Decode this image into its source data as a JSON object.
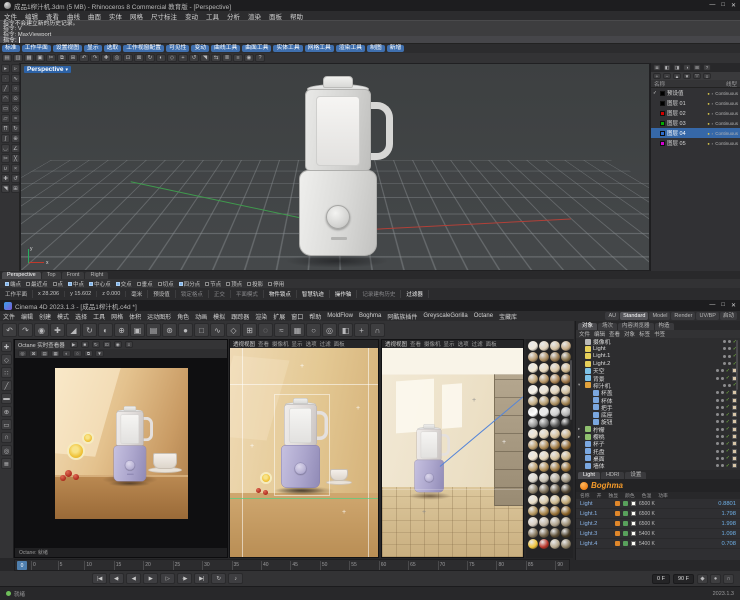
{
  "rhino": {
    "title": "成品1榨汁机.3dm (5 MB) - Rhinoceros 8 Commercial 教育版 - [Perspective]",
    "window_buttons": [
      "—",
      "□",
      "✕"
    ],
    "menus": [
      "文件",
      "编辑",
      "查看",
      "曲线",
      "曲面",
      "实体",
      "网格",
      "尺寸标注",
      "变动",
      "工具",
      "分析",
      "渲染",
      "面板",
      "帮助"
    ],
    "command_history": [
      "指令不会建立新的历史记录。",
      "指令: V",
      "指令: MaxViewport"
    ],
    "command_prompt": "指令:",
    "toolbar_tabs": [
      "标准",
      "工作平面",
      "设置视图",
      "显示",
      "选取",
      "工作视窗配置",
      "可见性",
      "变动",
      "曲线工具",
      "曲面工具",
      "实体工具",
      "网格工具",
      "渲染工具",
      "制图",
      "新增"
    ],
    "toolbar_icons": [
      {
        "n": "new-file-icon",
        "g": "▤"
      },
      {
        "n": "open-file-icon",
        "g": "▥"
      },
      {
        "n": "save-icon",
        "g": "▦"
      },
      {
        "n": "print-icon",
        "g": "▣"
      },
      {
        "n": "cut-icon",
        "g": "✂"
      },
      {
        "n": "copy-icon",
        "g": "⧉"
      },
      {
        "n": "paste-icon",
        "g": "⊞"
      },
      {
        "n": "undo-icon",
        "g": "↶"
      },
      {
        "n": "redo-icon",
        "g": "↷"
      },
      {
        "n": "pan-view-icon",
        "g": "✚"
      },
      {
        "n": "zoom-icon",
        "g": "◎"
      },
      {
        "n": "zoom-window-icon",
        "g": "⊡"
      },
      {
        "n": "zoom-extents-icon",
        "g": "⊠"
      },
      {
        "n": "rotate-view-icon",
        "g": "↻"
      },
      {
        "n": "shaded-display-icon",
        "g": "◐"
      },
      {
        "n": "wireframe-display-icon",
        "g": "◇"
      },
      {
        "n": "move-icon",
        "g": "+"
      },
      {
        "n": "rotate-icon",
        "g": "↺"
      },
      {
        "n": "scale-icon",
        "g": "◥"
      },
      {
        "n": "mirror-icon",
        "g": "⇆"
      },
      {
        "n": "layers-icon",
        "g": "≣"
      },
      {
        "n": "properties-icon",
        "g": "≡"
      },
      {
        "n": "osnap-icon",
        "g": "◉"
      },
      {
        "n": "help-icon",
        "g": "?"
      }
    ],
    "left_tool_icons": [
      {
        "n": "select-tool-icon",
        "g": "▸"
      },
      {
        "n": "selection-filter-icon",
        "g": "▹"
      },
      {
        "n": "point-tool-icon",
        "g": "∙"
      },
      {
        "n": "curve-tool-icon",
        "g": "∿"
      },
      {
        "n": "polyline-tool-icon",
        "g": "╱"
      },
      {
        "n": "circle-tool-icon",
        "g": "○"
      },
      {
        "n": "arc-tool-icon",
        "g": "◠"
      },
      {
        "n": "ellipse-tool-icon",
        "g": "⊙"
      },
      {
        "n": "rectangle-tool-icon",
        "g": "▭"
      },
      {
        "n": "polygon-tool-icon",
        "g": "◇"
      },
      {
        "n": "surface-tool-icon",
        "g": "▱"
      },
      {
        "n": "loft-tool-icon",
        "g": "≈"
      },
      {
        "n": "extrude-tool-icon",
        "g": "⇈"
      },
      {
        "n": "revolve-tool-icon",
        "g": "↻"
      },
      {
        "n": "sweep-tool-icon",
        "g": "∫"
      },
      {
        "n": "boolean-tool-icon",
        "g": "⊕"
      },
      {
        "n": "fillet-tool-icon",
        "g": "◡"
      },
      {
        "n": "chamfer-tool-icon",
        "g": "∠"
      },
      {
        "n": "trim-tool-icon",
        "g": "✂"
      },
      {
        "n": "split-tool-icon",
        "g": "╳"
      },
      {
        "n": "join-tool-icon",
        "g": "∪"
      },
      {
        "n": "explode-tool-icon",
        "g": "×"
      },
      {
        "n": "move-tool-icon",
        "g": "✚"
      },
      {
        "n": "rotate-tool-icon",
        "g": "↺"
      },
      {
        "n": "scale-tool-icon",
        "g": "◥"
      },
      {
        "n": "array-tool-icon",
        "g": "⊞"
      }
    ],
    "viewport": {
      "label": "Perspective",
      "axis_x": "x",
      "axis_y": "y"
    },
    "layers_panel": {
      "tab_icons": [
        {
          "n": "layers-panel-icon",
          "g": "≣"
        },
        {
          "n": "properties-panel-icon",
          "g": "◧"
        },
        {
          "n": "display-panel-icon",
          "g": "◨"
        },
        {
          "n": "materials-panel-icon",
          "g": "◑"
        },
        {
          "n": "boxedit-panel-icon",
          "g": "⊞"
        },
        {
          "n": "help-panel-icon",
          "g": "?"
        }
      ],
      "tool_icons": [
        {
          "n": "new-layer-icon",
          "g": "+"
        },
        {
          "n": "delete-layer-icon",
          "g": "−"
        },
        {
          "n": "move-layer-up-icon",
          "g": "▲"
        },
        {
          "n": "move-layer-down-icon",
          "g": "▼"
        },
        {
          "n": "filter-layers-icon",
          "g": "▽"
        },
        {
          "n": "layer-menu-icon",
          "g": "≡"
        }
      ],
      "name_column": "名称",
      "linetype_column": "线型",
      "rows": [
        {
          "name": "预设值",
          "color": "#000000",
          "linetype": "Continuous",
          "current": true,
          "selected": false
        },
        {
          "name": "图层 01",
          "color": "#000000",
          "linetype": "Continuous",
          "current": false,
          "selected": false
        },
        {
          "name": "图层 02",
          "color": "#d40000",
          "linetype": "Continuous",
          "current": false,
          "selected": false
        },
        {
          "name": "图层 03",
          "color": "#00b000",
          "linetype": "Continuous",
          "current": false,
          "selected": false
        },
        {
          "name": "图层 04",
          "color": "#2f6fd0",
          "linetype": "Continuous",
          "current": false,
          "selected": true
        },
        {
          "name": "图层 05",
          "color": "#d400d4",
          "linetype": "Continuous",
          "current": false,
          "selected": false
        }
      ]
    },
    "viewport_tabs": [
      {
        "label": "Perspective",
        "active": true
      },
      {
        "label": "Top",
        "active": false
      },
      {
        "label": "Front",
        "active": false
      },
      {
        "label": "Right",
        "active": false
      }
    ],
    "osnap": [
      {
        "label": "端点",
        "on": true
      },
      {
        "label": "最近点",
        "on": false
      },
      {
        "label": "点",
        "on": false
      },
      {
        "label": "中点",
        "on": true
      },
      {
        "label": "中心点",
        "on": true
      },
      {
        "label": "交点",
        "on": true
      },
      {
        "label": "垂点",
        "on": false
      },
      {
        "label": "切点",
        "on": false
      },
      {
        "label": "四分点",
        "on": true
      },
      {
        "label": "节点",
        "on": false
      },
      {
        "label": "顶点",
        "on": false
      },
      {
        "label": "投影",
        "on": false
      },
      {
        "label": "停用",
        "on": false
      }
    ],
    "status_bar": {
      "left": [
        "工作平面",
        "x 28.206",
        "y 15.602",
        "z 0.000",
        "毫米",
        "预设值"
      ],
      "toggles": [
        {
          "label": "锁定格点",
          "on": false
        },
        {
          "label": "正交",
          "on": false
        },
        {
          "label": "平面模式",
          "on": false
        },
        {
          "label": "物件锁点",
          "on": true
        },
        {
          "label": "智慧轨迹",
          "on": true
        },
        {
          "label": "操作轴",
          "on": true
        },
        {
          "label": "记录建构历史",
          "on": false
        },
        {
          "label": "过滤器",
          "on": true
        }
      ]
    }
  },
  "c4d": {
    "title": "Cinema 4D 2023.1.3 - [成品1榨汁机.c4d *]",
    "window_buttons": [
      "—",
      "□",
      "✕"
    ],
    "menus": [
      "文件",
      "编辑",
      "创建",
      "模式",
      "选择",
      "工具",
      "网格",
      "体积",
      "运动图形",
      "角色",
      "动画",
      "模拟",
      "跟踪器",
      "渲染",
      "扩展",
      "窗口",
      "帮助",
      "MoldFlow",
      "Boghma",
      "阿酷族插件",
      "GreyscaleGorilla",
      "Octane",
      "宝藏库"
    ],
    "layout_tabs": [
      {
        "label": "AU",
        "active": false
      },
      {
        "label": "Standard",
        "active": true
      },
      {
        "label": "Model",
        "active": false
      },
      {
        "label": "Render",
        "active": false
      },
      {
        "label": "UV/BP",
        "active": false
      },
      {
        "label": "启动",
        "active": false
      }
    ],
    "toolbar_icons": [
      {
        "n": "undo-icon",
        "g": "↶"
      },
      {
        "n": "redo-icon",
        "g": "↷"
      },
      {
        "n": "live-selection-icon",
        "g": "◉"
      },
      {
        "n": "move-icon",
        "g": "✚"
      },
      {
        "n": "scale-icon",
        "g": "◢"
      },
      {
        "n": "rotate-icon",
        "g": "↻"
      },
      {
        "n": "last-tools-icon",
        "g": "◐"
      },
      {
        "n": "coordinate-system-icon",
        "g": "⊕"
      },
      {
        "n": "render-view-icon",
        "g": "▣"
      },
      {
        "n": "render-picture-viewer-icon",
        "g": "▤"
      },
      {
        "n": "render-settings-icon",
        "g": "⊛"
      },
      {
        "n": "new-material-icon",
        "g": "●"
      },
      {
        "n": "cube-primitive-icon",
        "g": "□"
      },
      {
        "n": "pen-spline-icon",
        "g": "∿"
      },
      {
        "n": "subdivision-surface-icon",
        "g": "◇"
      },
      {
        "n": "mograph-icon",
        "g": "⊞"
      },
      {
        "n": "deformer-icon",
        "g": "◌"
      },
      {
        "n": "fields-icon",
        "g": "≈"
      },
      {
        "n": "volume-icon",
        "g": "▦"
      },
      {
        "n": "dynamics-icon",
        "g": "○"
      },
      {
        "n": "camera-icon",
        "g": "◎"
      },
      {
        "n": "display-mode-icon",
        "g": "◧"
      },
      {
        "n": "axis-icon",
        "g": "+"
      },
      {
        "n": "snap-icon",
        "g": "∩"
      }
    ],
    "side_icons": [
      {
        "n": "move-mode-icon",
        "g": "✚"
      },
      {
        "n": "model-mode-icon",
        "g": "◇"
      },
      {
        "n": "point-mode-icon",
        "g": "∷"
      },
      {
        "n": "edge-mode-icon",
        "g": "╱"
      },
      {
        "n": "polygon-mode-icon",
        "g": "▬"
      },
      {
        "n": "axis-mode-icon",
        "g": "⊕"
      },
      {
        "n": "workplane-icon",
        "g": "▭"
      },
      {
        "n": "snap-toggle-icon",
        "g": "∩"
      },
      {
        "n": "viewport-solo-icon",
        "g": "◎"
      },
      {
        "n": "layers-icon",
        "g": "≣"
      }
    ],
    "live_viewer": {
      "title": "Octane 实时查看器",
      "h1_icons": [
        {
          "n": "render-start-icon",
          "g": "▶"
        },
        {
          "n": "render-stop-icon",
          "g": "■"
        },
        {
          "n": "render-restart-icon",
          "g": "↻"
        },
        {
          "n": "region-render-icon",
          "g": "⊡"
        },
        {
          "n": "focus-pick-icon",
          "g": "◉"
        },
        {
          "n": "viewer-menu-icon",
          "g": "≡"
        }
      ],
      "h2_icons": [
        {
          "n": "camera-icon",
          "g": "◎"
        },
        {
          "n": "lock-resolution-icon",
          "g": "⊠"
        },
        {
          "n": "passes-icon",
          "g": "▤"
        },
        {
          "n": "aov-icon",
          "g": "▦"
        },
        {
          "n": "denoise-icon",
          "g": "◐"
        },
        {
          "n": "clay-mode-icon",
          "g": "○"
        },
        {
          "n": "picture-viewer-icon",
          "g": "⧉"
        },
        {
          "n": "save-image-icon",
          "g": "▼"
        }
      ],
      "status": "Octane: 就绪"
    },
    "viewport_menu": [
      "查看",
      "摄像机",
      "显示",
      "选项",
      "过滤",
      "面板"
    ],
    "viewports": {
      "mid_label": "透视视图",
      "right_label": "透视视图"
    },
    "materials": [
      "#efe7d9",
      "#e3d4bd",
      "#d6c2a2",
      "#c9ad87",
      "#b99a6f",
      "#a98a5e",
      "#987a50",
      "#867046",
      "#f4ead6",
      "#e8d9bf",
      "#dcc8a6",
      "#cfb78e",
      "#c2a577",
      "#b59363",
      "#a88253",
      "#9a7345",
      "#f7f2e8",
      "#ece2d0",
      "#e0d2b8",
      "#d3c19f",
      "#c6b088",
      "#b89f72",
      "#ab8e5e",
      "#9d7e4c",
      "#ffffff",
      "#e9e9e9",
      "#cfcfcf",
      "#b4b4b4",
      "#979797",
      "#787878",
      "#565656",
      "#2e2e2e",
      "#efe3cf",
      "#e2d2b5",
      "#d5c09a",
      "#c8ae81",
      "#bb9c6a",
      "#ae8b55",
      "#a07a43",
      "#926a33",
      "#f2e6d2",
      "#e5d5b8",
      "#d8c49d",
      "#cbb284",
      "#bea06d",
      "#b18f58",
      "#a37e45",
      "#956e35",
      "#ddd8ce",
      "#c9c2b4",
      "#b5ac9a",
      "#a19682",
      "#8d816b",
      "#796c56",
      "#655843",
      "#514532",
      "#e8ddc8",
      "#dbcbaa",
      "#cdb98e",
      "#c0a774",
      "#b3955d",
      "#a68348",
      "#987236",
      "#8a6226",
      "#d9cfc2",
      "#c4b8a6",
      "#afa28c",
      "#9a8c73",
      "#85765c",
      "#706147",
      "#5b4d35",
      "#463a26",
      "#f0c43c",
      "#b8352a",
      "#b7a98e",
      "#8f8268"
    ],
    "object_manager": {
      "tabs": [
        {
          "label": "对象",
          "active": true
        },
        {
          "label": "场次",
          "active": false
        },
        {
          "label": "内容浏览器",
          "active": false
        },
        {
          "label": "构造",
          "active": false
        }
      ],
      "menu": [
        "文件",
        "编辑",
        "查看",
        "对象",
        "标签",
        "书签"
      ],
      "rows": [
        {
          "name": "摄像机",
          "icon": "#b8b8b8",
          "d": 0,
          "caret": "",
          "tag": false
        },
        {
          "name": "Light",
          "icon": "#e6d05a",
          "d": 0,
          "caret": "",
          "tag": false
        },
        {
          "name": "Light.1",
          "icon": "#e6d05a",
          "d": 0,
          "caret": "",
          "tag": false
        },
        {
          "name": "Light.2",
          "icon": "#e6d05a",
          "d": 0,
          "caret": "",
          "tag": false
        },
        {
          "name": "天空",
          "icon": "#7ec3e8",
          "d": 0,
          "caret": "",
          "tag": true
        },
        {
          "name": "背景",
          "icon": "#7ec3e8",
          "d": 0,
          "caret": "",
          "tag": true
        },
        {
          "name": "榨汁机",
          "icon": "#e0a13c",
          "d": 0,
          "caret": "▾",
          "tag": false
        },
        {
          "name": "杯盖",
          "icon": "#7aa7e0",
          "d": 1,
          "caret": "",
          "tag": true
        },
        {
          "name": "杯体",
          "icon": "#7aa7e0",
          "d": 1,
          "caret": "",
          "tag": true
        },
        {
          "name": "把手",
          "icon": "#7aa7e0",
          "d": 1,
          "caret": "",
          "tag": true
        },
        {
          "name": "底座",
          "icon": "#7aa7e0",
          "d": 1,
          "caret": "",
          "tag": true
        },
        {
          "name": "旋钮",
          "icon": "#7aa7e0",
          "d": 1,
          "caret": "",
          "tag": true
        },
        {
          "name": "柠檬",
          "icon": "#8fc06f",
          "d": 0,
          "caret": "▸",
          "tag": true
        },
        {
          "name": "樱桃",
          "icon": "#8fc06f",
          "d": 0,
          "caret": "▸",
          "tag": true
        },
        {
          "name": "杯子",
          "icon": "#7aa7e0",
          "d": 0,
          "caret": "",
          "tag": true
        },
        {
          "name": "托盘",
          "icon": "#7aa7e0",
          "d": 0,
          "caret": "",
          "tag": true
        },
        {
          "name": "桌面",
          "icon": "#7aa7e0",
          "d": 0,
          "caret": "",
          "tag": true
        },
        {
          "name": "墙体",
          "icon": "#7aa7e0",
          "d": 0,
          "caret": "",
          "tag": true
        }
      ]
    },
    "light_lister": {
      "tabs": [
        {
          "label": "Light",
          "active": true
        },
        {
          "label": "HDRI",
          "active": false
        },
        {
          "label": "设置",
          "active": false
        }
      ],
      "logo": "Boghma",
      "columns": [
        "名称",
        "开",
        "独显",
        "颜色",
        "色温",
        "功率"
      ],
      "rows": [
        {
          "name": "Light",
          "temp": "6500 K",
          "power": "0.8801"
        },
        {
          "name": "Light.1",
          "temp": "6500 K",
          "power": "1.798"
        },
        {
          "name": "Light.2",
          "temp": "6500 K",
          "power": "1.998"
        },
        {
          "name": "Light.3",
          "temp": "5400 K",
          "power": "1.098"
        },
        {
          "name": "Light.4",
          "temp": "5400 K",
          "power": "0.708"
        }
      ]
    },
    "timeline": {
      "ticks": [
        0,
        5,
        10,
        15,
        20,
        25,
        30,
        35,
        40,
        45,
        50,
        55,
        60,
        65,
        70,
        75,
        80,
        85,
        90
      ],
      "current": "0"
    },
    "transport": {
      "buttons": [
        {
          "n": "go-to-start-button",
          "g": "|◀"
        },
        {
          "n": "previous-key-button",
          "g": "◀·"
        },
        {
          "n": "previous-frame-button",
          "g": "◀"
        },
        {
          "n": "play-button",
          "g": "▶"
        },
        {
          "n": "next-frame-button",
          "g": "▷"
        },
        {
          "n": "next-key-button",
          "g": "·▶"
        },
        {
          "n": "go-to-end-button",
          "g": "▶|"
        },
        {
          "n": "loop-button",
          "g": "↻"
        },
        {
          "n": "sound-button",
          "g": "♪"
        }
      ],
      "fields": [
        "0 F",
        "90 F"
      ],
      "right_icons": [
        {
          "n": "keyframe-icon",
          "g": "◆"
        },
        {
          "n": "autokey-icon",
          "g": "●"
        },
        {
          "n": "snap-key-icon",
          "g": "∩"
        }
      ]
    },
    "status": {
      "left": "就绪",
      "right": "2023.1.3"
    }
  }
}
